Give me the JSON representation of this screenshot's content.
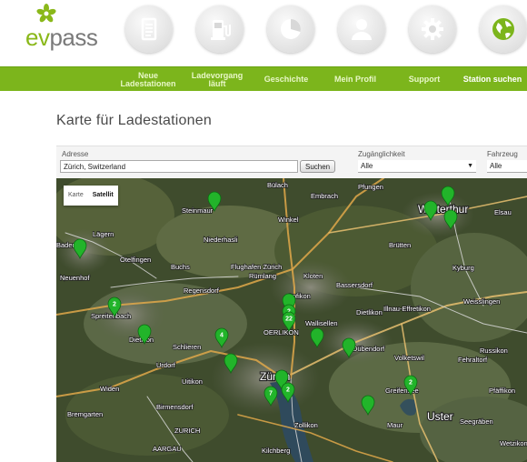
{
  "header": {
    "logo_ev": "ev",
    "logo_pass": "pass",
    "icons": [
      "document-icon",
      "charging-station-icon",
      "pie-chart-icon",
      "user-icon",
      "gear-icon",
      "globe-icon"
    ]
  },
  "nav": {
    "items": [
      {
        "line1": "Neue",
        "line2": "Ladestationen"
      },
      {
        "line1": "Ladevorgang",
        "line2": "läuft"
      },
      {
        "line1": "Geschichte",
        "line2": ""
      },
      {
        "line1": "Mein Profil",
        "line2": ""
      },
      {
        "line1": "Support",
        "line2": ""
      },
      {
        "line1": "Station suchen",
        "line2": ""
      }
    ]
  },
  "page": {
    "title": "Karte für Ladestationen"
  },
  "filters": {
    "address_label": "Adresse",
    "address_value": "Zürich, Switzerland",
    "search_button": "Suchen",
    "access_label": "Zugänglichkeit",
    "access_value": "Alle",
    "vehicle_label": "Fahrzeug",
    "vehicle_value": "Alle"
  },
  "map": {
    "type_map": "Karte",
    "type_satellite": "Satellit",
    "marker_color": "#22b42a",
    "places": [
      {
        "name": "Bülach",
        "big": false
      },
      {
        "name": "Embrach",
        "big": false
      },
      {
        "name": "Pfungen",
        "big": false
      },
      {
        "name": "Winterthur",
        "big": true
      },
      {
        "name": "Elsau",
        "big": false
      },
      {
        "name": "Steinmaur",
        "big": false
      },
      {
        "name": "Winkel",
        "big": false
      },
      {
        "name": "Niederhasli",
        "big": false
      },
      {
        "name": "Lägern",
        "big": false
      },
      {
        "name": "Brütten",
        "big": false
      },
      {
        "name": "Baden",
        "big": false
      },
      {
        "name": "Otelfingen",
        "big": false
      },
      {
        "name": "Buchs",
        "big": false
      },
      {
        "name": "Flughafen Zürich",
        "big": false
      },
      {
        "name": "Rümlang",
        "big": false
      },
      {
        "name": "Kloten",
        "big": false
      },
      {
        "name": "Kyburg",
        "big": false
      },
      {
        "name": "Neuenhof",
        "big": false
      },
      {
        "name": "Regensdorf",
        "big": false
      },
      {
        "name": "Bassersdorf",
        "big": false
      },
      {
        "name": "Opfikon",
        "big": false
      },
      {
        "name": "Spreitenbach",
        "big": false
      },
      {
        "name": "Dietlikon",
        "big": false
      },
      {
        "name": "Illnau-Effretikon",
        "big": false
      },
      {
        "name": "Weisslingen",
        "big": false
      },
      {
        "name": "Wallisellen",
        "big": false
      },
      {
        "name": "OERLIKON",
        "big": false
      },
      {
        "name": "Dietikon",
        "big": false
      },
      {
        "name": "Schlieren",
        "big": false
      },
      {
        "name": "Dübendorf",
        "big": false
      },
      {
        "name": "Russikon",
        "big": false
      },
      {
        "name": "Volketswil",
        "big": false
      },
      {
        "name": "Fehraltorf",
        "big": false
      },
      {
        "name": "Urdorf",
        "big": false
      },
      {
        "name": "Zürich",
        "big": true
      },
      {
        "name": "Widen",
        "big": false
      },
      {
        "name": "Uitikon",
        "big": false
      },
      {
        "name": "Greifensee",
        "big": false
      },
      {
        "name": "Pfäffikon",
        "big": false
      },
      {
        "name": "Birmensdorf",
        "big": false
      },
      {
        "name": "Uster",
        "big": true
      },
      {
        "name": "Bremgarten",
        "big": false
      },
      {
        "name": "Zollikon",
        "big": false
      },
      {
        "name": "Maur",
        "big": false
      },
      {
        "name": "Seegräben",
        "big": false
      },
      {
        "name": "Wetzikon",
        "big": false
      },
      {
        "name": "Kilchberg",
        "big": false
      },
      {
        "name": "ZURICH",
        "big": false
      },
      {
        "name": "AARGAU",
        "big": false
      }
    ],
    "markers": [
      {
        "label": ""
      },
      {
        "label": ""
      },
      {
        "label": ""
      },
      {
        "label": ""
      },
      {
        "label": ""
      },
      {
        "label": "2"
      },
      {
        "label": ""
      },
      {
        "label": "2"
      },
      {
        "label": "22"
      },
      {
        "label": ""
      },
      {
        "label": "4"
      },
      {
        "label": ""
      },
      {
        "label": ""
      },
      {
        "label": ""
      },
      {
        "label": "2"
      },
      {
        "label": "7"
      },
      {
        "label": ""
      },
      {
        "label": "2"
      },
      {
        "label": ""
      }
    ]
  }
}
